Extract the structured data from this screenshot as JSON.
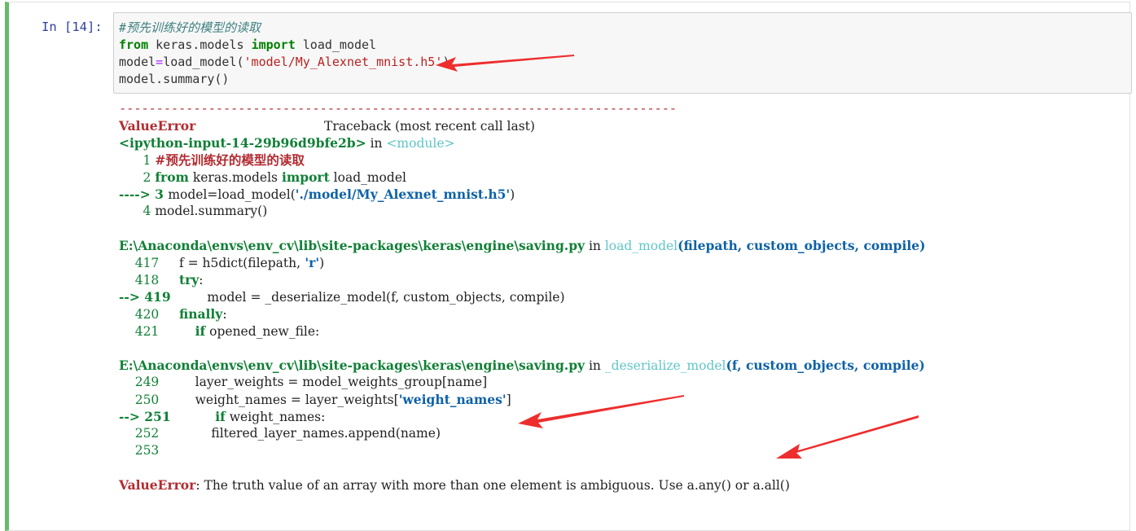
{
  "prompt": "In [14]:",
  "input_lines": [
    [
      {
        "t": "#预先训练好的模型的读取",
        "c": "cm-comment"
      }
    ],
    [
      {
        "t": "from",
        "c": "cm-keyword"
      },
      {
        "t": " keras.models ",
        "c": "cm-name"
      },
      {
        "t": "import",
        "c": "cm-keyword"
      },
      {
        "t": " load_model",
        "c": "cm-name"
      }
    ],
    [
      {
        "t": "model",
        "c": "cm-name"
      },
      {
        "t": "=",
        "c": "cm-op"
      },
      {
        "t": "load_model(",
        "c": "cm-name"
      },
      {
        "t": "'model/My_Alexnet_mnist.h5'",
        "c": "cm-string"
      },
      {
        "t": ")",
        "c": "cm-name"
      }
    ],
    [
      {
        "t": "model.summary",
        "c": "cm-name"
      },
      {
        "t": "()",
        "c": "cm-paren"
      }
    ]
  ],
  "output_lines": [
    [
      {
        "t": "---------------------------------------------------------------------------",
        "c": "dash"
      }
    ],
    [
      {
        "t": "ValueError",
        "c": "err"
      },
      {
        "t": "                                Traceback (most recent call last)",
        "c": ""
      }
    ],
    [
      {
        "t": "<ipython-input-14-29b96d9bfe2b>",
        "c": "grn"
      },
      {
        "t": " in ",
        "c": ""
      },
      {
        "t": "<module>",
        "c": "cyn"
      }
    ],
    [
      {
        "t": "      1 ",
        "c": "grn-n"
      },
      {
        "t": "#预先训练好的模型的读取",
        "c": "err"
      }
    ],
    [
      {
        "t": "      2 ",
        "c": "grn-n"
      },
      {
        "t": "from",
        "c": "grn"
      },
      {
        "t": " keras.models ",
        "c": ""
      },
      {
        "t": "import",
        "c": "grn"
      },
      {
        "t": " load_model",
        "c": ""
      }
    ],
    [
      {
        "t": "----> 3 ",
        "c": "grn"
      },
      {
        "t": "model",
        "c": ""
      },
      {
        "t": "=",
        "c": ""
      },
      {
        "t": "load_model",
        "c": ""
      },
      {
        "t": "(",
        "c": ""
      },
      {
        "t": "'./model/My_Alexnet_mnist.h5'",
        "c": "blu"
      },
      {
        "t": ")",
        "c": ""
      }
    ],
    [
      {
        "t": "      4 ",
        "c": "grn-n"
      },
      {
        "t": "model",
        "c": ""
      },
      {
        "t": ".",
        "c": ""
      },
      {
        "t": "summary",
        "c": ""
      },
      {
        "t": "()",
        "c": ""
      }
    ],
    [
      {
        "t": " ",
        "c": ""
      }
    ],
    [
      {
        "t": "E:\\Anaconda\\envs\\env_cv\\lib\\site-packages\\keras\\engine\\saving.py",
        "c": "grn"
      },
      {
        "t": " in ",
        "c": ""
      },
      {
        "t": "load_model",
        "c": "cyn"
      },
      {
        "t": "(filepath, custom_objects, compile)",
        "c": "blu"
      }
    ],
    [
      {
        "t": "    417 ",
        "c": "grn-n"
      },
      {
        "t": "    f ",
        "c": ""
      },
      {
        "t": "=",
        "c": ""
      },
      {
        "t": " h5dict",
        "c": ""
      },
      {
        "t": "(",
        "c": ""
      },
      {
        "t": "filepath",
        "c": ""
      },
      {
        "t": ",",
        "c": ""
      },
      {
        "t": " 'r'",
        "c": "blu"
      },
      {
        "t": ")",
        "c": ""
      }
    ],
    [
      {
        "t": "    418 ",
        "c": "grn-n"
      },
      {
        "t": "    ",
        "c": ""
      },
      {
        "t": "try",
        "c": "grn"
      },
      {
        "t": ":",
        "c": ""
      }
    ],
    [
      {
        "t": "--> 419 ",
        "c": "grn"
      },
      {
        "t": "        model ",
        "c": ""
      },
      {
        "t": "=",
        "c": ""
      },
      {
        "t": " _deserialize_model",
        "c": ""
      },
      {
        "t": "(",
        "c": ""
      },
      {
        "t": "f",
        "c": ""
      },
      {
        "t": ",",
        "c": ""
      },
      {
        "t": " custom_objects",
        "c": ""
      },
      {
        "t": ",",
        "c": ""
      },
      {
        "t": " compile",
        "c": ""
      },
      {
        "t": ")",
        "c": ""
      }
    ],
    [
      {
        "t": "    420 ",
        "c": "grn-n"
      },
      {
        "t": "    ",
        "c": ""
      },
      {
        "t": "finally",
        "c": "grn"
      },
      {
        "t": ":",
        "c": ""
      }
    ],
    [
      {
        "t": "    421 ",
        "c": "grn-n"
      },
      {
        "t": "        ",
        "c": ""
      },
      {
        "t": "if",
        "c": "grn"
      },
      {
        "t": " opened_new_file",
        "c": ""
      },
      {
        "t": ":",
        "c": ""
      }
    ],
    [
      {
        "t": " ",
        "c": ""
      }
    ],
    [
      {
        "t": "E:\\Anaconda\\envs\\env_cv\\lib\\site-packages\\keras\\engine\\saving.py",
        "c": "grn"
      },
      {
        "t": " in ",
        "c": ""
      },
      {
        "t": "_deserialize_model",
        "c": "cyn"
      },
      {
        "t": "(f, custom_objects, compile)",
        "c": "blu"
      }
    ],
    [
      {
        "t": "    249 ",
        "c": "grn-n"
      },
      {
        "t": "        layer_weights ",
        "c": ""
      },
      {
        "t": "=",
        "c": ""
      },
      {
        "t": " model_weights_group",
        "c": ""
      },
      {
        "t": "[",
        "c": ""
      },
      {
        "t": "name",
        "c": ""
      },
      {
        "t": "]",
        "c": ""
      }
    ],
    [
      {
        "t": "    250 ",
        "c": "grn-n"
      },
      {
        "t": "        weight_names ",
        "c": ""
      },
      {
        "t": "=",
        "c": ""
      },
      {
        "t": " layer_weights",
        "c": ""
      },
      {
        "t": "[",
        "c": ""
      },
      {
        "t": "'weight_names'",
        "c": "blu"
      },
      {
        "t": "]",
        "c": ""
      }
    ],
    [
      {
        "t": "--> 251 ",
        "c": "grn"
      },
      {
        "t": "          ",
        "c": ""
      },
      {
        "t": "if",
        "c": "grn"
      },
      {
        "t": " weight_names",
        "c": ""
      },
      {
        "t": ":",
        "c": ""
      }
    ],
    [
      {
        "t": "    252 ",
        "c": "grn-n"
      },
      {
        "t": "            filtered_layer_names",
        "c": ""
      },
      {
        "t": ".",
        "c": ""
      },
      {
        "t": "append",
        "c": ""
      },
      {
        "t": "(",
        "c": ""
      },
      {
        "t": "name",
        "c": ""
      },
      {
        "t": ")",
        "c": ""
      }
    ],
    [
      {
        "t": "    253 ",
        "c": "grn-n"
      }
    ],
    [
      {
        "t": " ",
        "c": ""
      }
    ],
    [
      {
        "t": "ValueError",
        "c": "err"
      },
      {
        "t": ": The truth value of an array with more than one element is ambiguous. Use a.any() or a.all()",
        "c": ""
      }
    ]
  ],
  "colors": {
    "accent_border": "#66bb6a",
    "error_red": "#b22b31",
    "annotation_arrow": "#ee2d2d"
  }
}
